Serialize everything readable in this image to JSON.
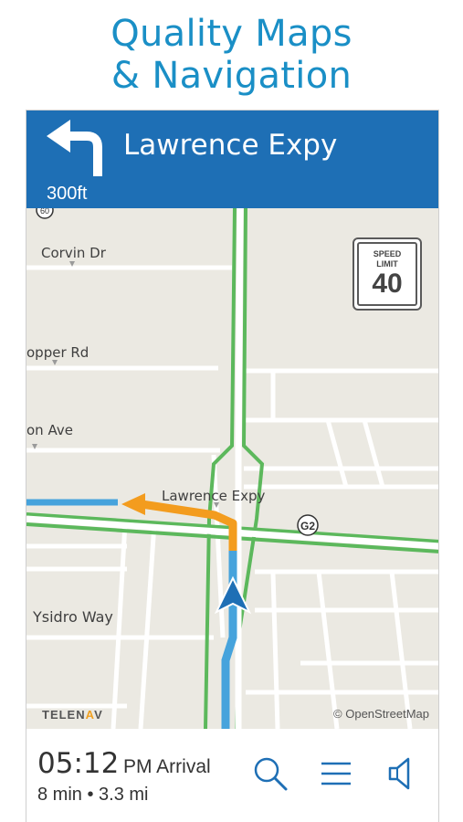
{
  "promo": {
    "line1": "Quality Maps",
    "line2": "& Navigation"
  },
  "nav": {
    "maneuver_icon": "turn-left-arrow-icon",
    "distance": "300ft",
    "street": "Lawrence Expy"
  },
  "map": {
    "labels": {
      "corvin": "Corvin Dr",
      "hopper": "opper Rd",
      "on_ave": "on Ave",
      "lawrence": "Lawrence Expy",
      "ysidro": "Ysidro Way"
    },
    "shield_g2": "G2",
    "shield_top": "60",
    "speed_limit": {
      "caption_line1": "SPEED",
      "caption_line2": "LIMIT",
      "value": "40"
    },
    "brand_prefix": "TELEN",
    "brand_accent": "A",
    "brand_suffix": "V",
    "attribution": "© OpenStreetMap"
  },
  "eta": {
    "time": "05:12",
    "suffix": "PM Arrival",
    "detail": "8 min • 3.3 mi"
  },
  "toolbar": {
    "search_icon": "search-icon",
    "menu_icon": "menu-icon",
    "sound_icon": "speaker-icon"
  },
  "colors": {
    "headline": "#1a8fc6",
    "banner": "#1e6fb5",
    "route": "#46a3dc",
    "turn": "#f39c1e",
    "highway": "#5cb85c",
    "map_bg": "#ebe9e2",
    "icon_blue": "#1e6fb5"
  }
}
